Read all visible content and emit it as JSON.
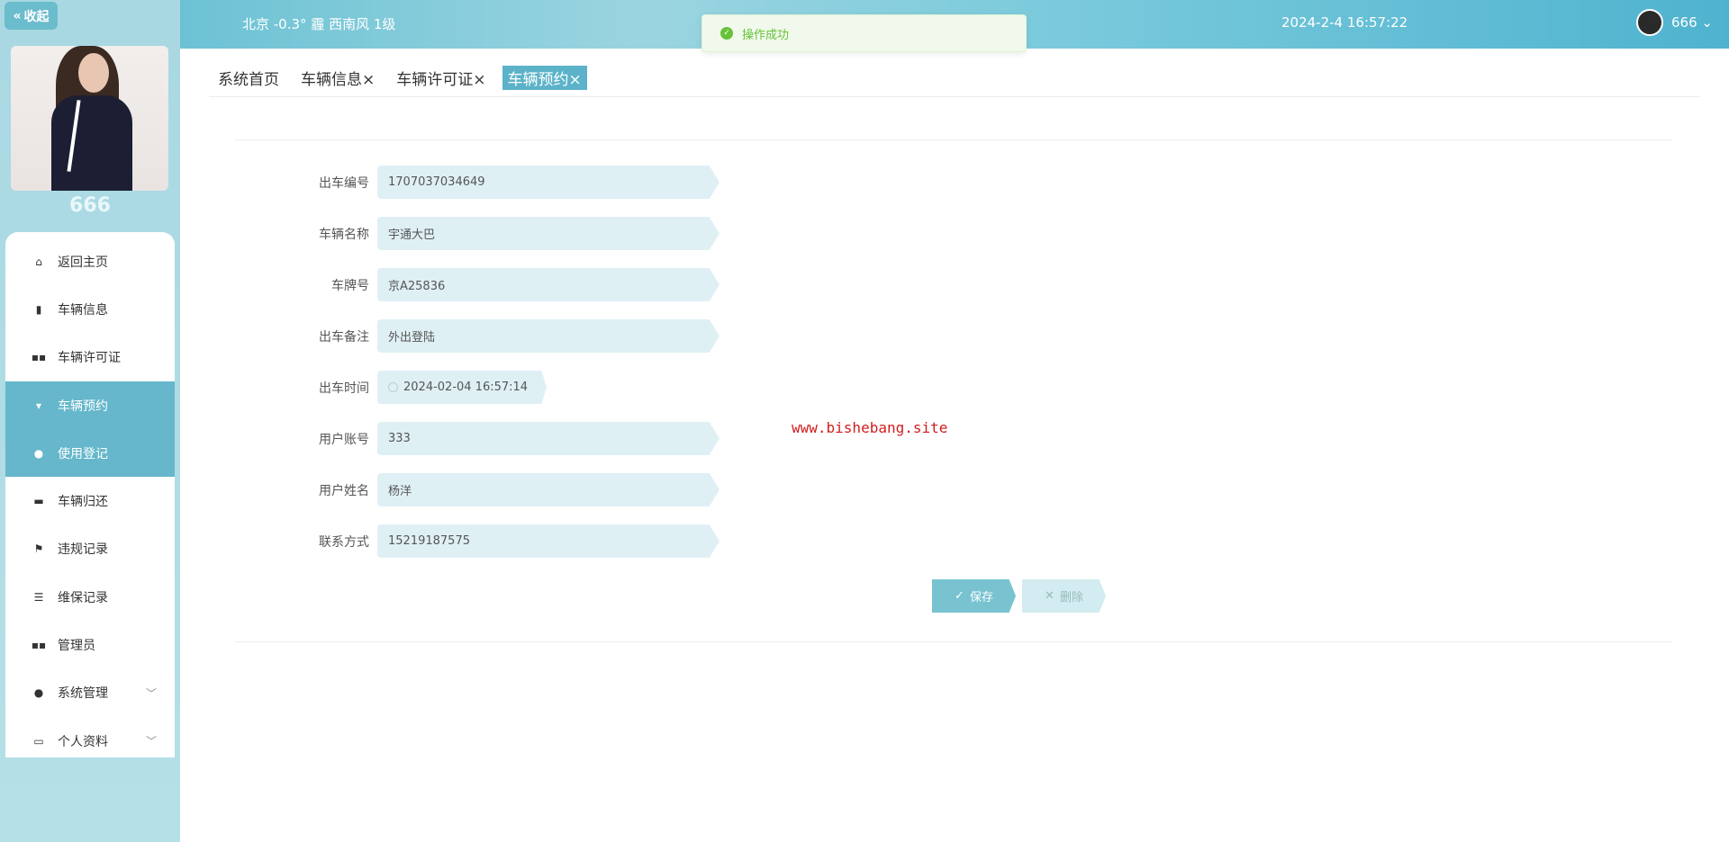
{
  "sidebar": {
    "collapse_label": "收起",
    "username": "666",
    "items": [
      {
        "label": "返回主页",
        "icon": "home-icon"
      },
      {
        "label": "车辆信息",
        "icon": "clipboard-icon"
      },
      {
        "label": "车辆许可证",
        "icon": "grid-icon"
      },
      {
        "label": "车辆预约",
        "icon": "thumb-icon",
        "active": true
      },
      {
        "label": "使用登记",
        "icon": "user-icon",
        "active": true
      },
      {
        "label": "车辆归还",
        "icon": "chat-icon"
      },
      {
        "label": "违规记录",
        "icon": "flag-icon"
      },
      {
        "label": "维保记录",
        "icon": "list-icon"
      },
      {
        "label": "管理员",
        "icon": "grid-icon"
      },
      {
        "label": "系统管理",
        "icon": "location-icon",
        "expand": true
      },
      {
        "label": "个人资料",
        "icon": "card-icon",
        "expand": true
      }
    ]
  },
  "header": {
    "weather": "北京  -0.3°  霾  西南风  1级",
    "datetime": "2024-2-4 16:57:22",
    "username": "666"
  },
  "toast": {
    "message": "操作成功"
  },
  "tabs": [
    {
      "label": "系统首页"
    },
    {
      "label": "车辆信息×"
    },
    {
      "label": "车辆许可证×"
    },
    {
      "label": "车辆预约×",
      "active": true
    }
  ],
  "form": {
    "fields": [
      {
        "label": "出车编号",
        "value": "1707037034649"
      },
      {
        "label": "车辆名称",
        "value": "宇通大巴"
      },
      {
        "label": "车牌号",
        "value": "京A25836"
      },
      {
        "label": "出车备注",
        "value": "外出登陆"
      },
      {
        "label": "出车时间",
        "value": "2024-02-04 16:57:14"
      },
      {
        "label": "用户账号",
        "value": "333"
      },
      {
        "label": "用户姓名",
        "value": "杨洋"
      },
      {
        "label": "联系方式",
        "value": "15219187575"
      }
    ],
    "save_label": "保存",
    "delete_label": "删除"
  },
  "watermark": "www.bishebang.site"
}
